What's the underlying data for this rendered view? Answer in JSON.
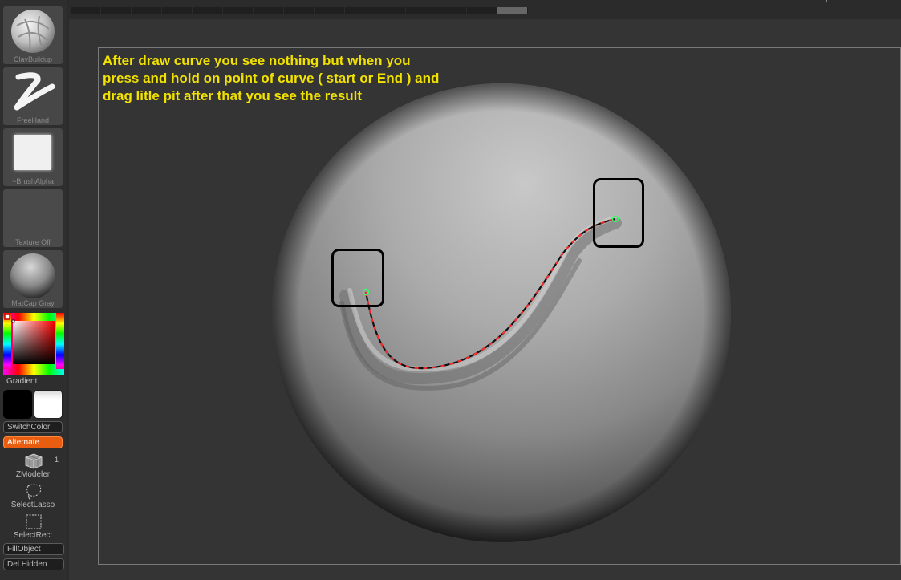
{
  "left_tray": {
    "brush_label": "ClayBuildup",
    "stroke_label": "FreeHand",
    "alpha_label": "~BrushAlpha",
    "texture_label": "Texture Off",
    "material_label": "MatCap Gray",
    "gradient_label": "Gradient",
    "switch_color_label": "SwitchColor",
    "alternate_label": "Alternate",
    "zmodeler_label": "ZModeler",
    "zmodeler_count": "1",
    "select_lasso_label": "SelectLasso",
    "select_rect_label": "SelectRect",
    "fill_object_label": "FillObject",
    "del_hidden_label": "Del Hidden"
  },
  "annotation": {
    "text": "After draw curve you see nothing but when you\npress and hold on point of curve ( start or End ) and\ndrag litle  pit after that you see the result"
  },
  "colors": {
    "annotation_text": "#f2e200",
    "alternate_active": "#e85d0f",
    "curve_dash": "#ff2a2a",
    "curve_point": "#33ff66"
  }
}
